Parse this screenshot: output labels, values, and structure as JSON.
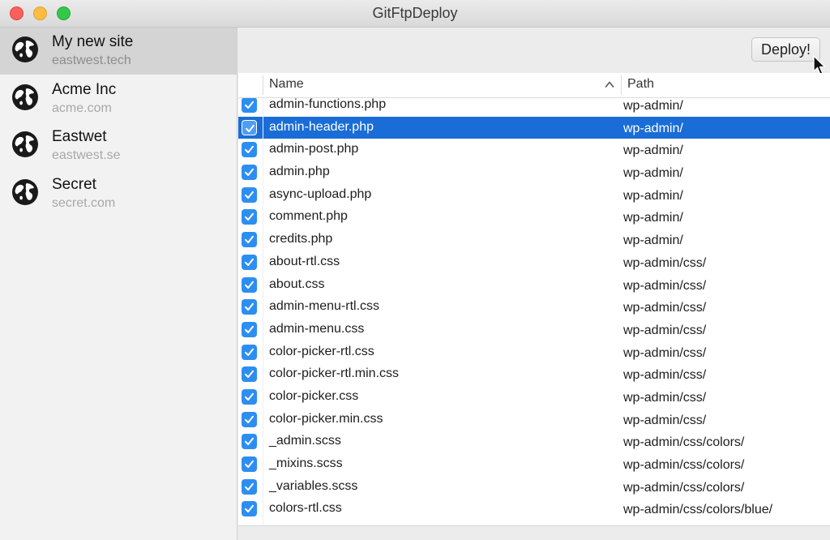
{
  "window": {
    "title": "GitFtpDeploy"
  },
  "sidebar": {
    "sites": [
      {
        "name": "My new site",
        "domain": "eastwest.tech",
        "selected": true
      },
      {
        "name": "Acme Inc",
        "domain": "acme.com",
        "selected": false
      },
      {
        "name": "Eastwet",
        "domain": "eastwest.se",
        "selected": false
      },
      {
        "name": "Secret",
        "domain": "secret.com",
        "selected": false
      }
    ]
  },
  "toolbar": {
    "deploy_label": "Deploy!"
  },
  "table": {
    "columns": {
      "name": "Name",
      "path": "Path"
    },
    "sort": "ascending",
    "rows": [
      {
        "file": "admin-functions.php",
        "path": "wp-admin/",
        "checked": true,
        "selected": false
      },
      {
        "file": "admin-header.php",
        "path": "wp-admin/",
        "checked": true,
        "selected": true
      },
      {
        "file": "admin-post.php",
        "path": "wp-admin/",
        "checked": true,
        "selected": false
      },
      {
        "file": "admin.php",
        "path": "wp-admin/",
        "checked": true,
        "selected": false
      },
      {
        "file": "async-upload.php",
        "path": "wp-admin/",
        "checked": true,
        "selected": false
      },
      {
        "file": "comment.php",
        "path": "wp-admin/",
        "checked": true,
        "selected": false
      },
      {
        "file": "credits.php",
        "path": "wp-admin/",
        "checked": true,
        "selected": false
      },
      {
        "file": "about-rtl.css",
        "path": "wp-admin/css/",
        "checked": true,
        "selected": false
      },
      {
        "file": "about.css",
        "path": "wp-admin/css/",
        "checked": true,
        "selected": false
      },
      {
        "file": "admin-menu-rtl.css",
        "path": "wp-admin/css/",
        "checked": true,
        "selected": false
      },
      {
        "file": "admin-menu.css",
        "path": "wp-admin/css/",
        "checked": true,
        "selected": false
      },
      {
        "file": "color-picker-rtl.css",
        "path": "wp-admin/css/",
        "checked": true,
        "selected": false
      },
      {
        "file": "color-picker-rtl.min.css",
        "path": "wp-admin/css/",
        "checked": true,
        "selected": false
      },
      {
        "file": "color-picker.css",
        "path": "wp-admin/css/",
        "checked": true,
        "selected": false
      },
      {
        "file": "color-picker.min.css",
        "path": "wp-admin/css/",
        "checked": true,
        "selected": false
      },
      {
        "file": "_admin.scss",
        "path": "wp-admin/css/colors/",
        "checked": true,
        "selected": false
      },
      {
        "file": "_mixins.scss",
        "path": "wp-admin/css/colors/",
        "checked": true,
        "selected": false
      },
      {
        "file": "_variables.scss",
        "path": "wp-admin/css/colors/",
        "checked": true,
        "selected": false
      },
      {
        "file": "colors-rtl.css",
        "path": "wp-admin/css/colors/blue/",
        "checked": true,
        "selected": false
      }
    ]
  },
  "colors": {
    "selection": "#1a6dd6",
    "checkbox": "#2d8ef2",
    "sidebar_selected": "#d4d4d4"
  },
  "icons": {
    "site": "globe-icon",
    "checkbox": "checkmark-icon",
    "sort": "sort-ascending-icon",
    "cursor": "mouse-pointer-icon"
  }
}
